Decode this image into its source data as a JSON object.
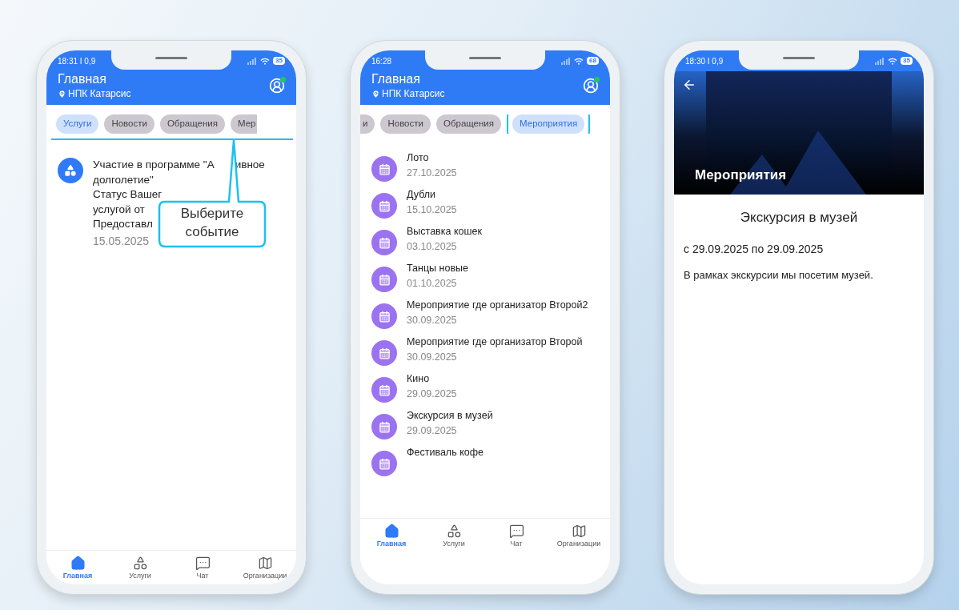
{
  "phones": [
    {
      "kind": "home",
      "status": {
        "time": "18:31 I 0,9",
        "battery": "35"
      },
      "header": {
        "title": "Главная",
        "location": "НПК Катарсис"
      },
      "tabs": [
        {
          "label": "Услуги",
          "selected": true,
          "highlighted": false
        },
        {
          "label": "Новости",
          "selected": false,
          "highlighted": false
        },
        {
          "label": "Обращения",
          "selected": false,
          "highlighted": false
        },
        {
          "label": "Мер",
          "selected": false,
          "highlighted": false,
          "clipped_right": true
        }
      ],
      "service": {
        "lines": [
          [
            "Участие в программе \"А",
            "ивное"
          ],
          [
            "долголетие\""
          ],
          [
            "Статус Вашег"
          ],
          [
            "услугой от"
          ],
          [
            "Предоставл"
          ]
        ],
        "date": "15.05.2025"
      },
      "callout": "Выберите событие",
      "nav": [
        {
          "label": "Главная",
          "selected": true
        },
        {
          "label": "Услуги",
          "selected": false
        },
        {
          "label": "Чат",
          "selected": false
        },
        {
          "label": "Организации",
          "selected": false
        }
      ]
    },
    {
      "kind": "events",
      "status": {
        "time": "16:28",
        "battery": "68"
      },
      "header": {
        "title": "Главная",
        "location": "НПК Катарсис"
      },
      "tabs": [
        {
          "label": "и",
          "selected": false,
          "highlighted": false,
          "clipped_left": true
        },
        {
          "label": "Новости",
          "selected": false,
          "highlighted": false
        },
        {
          "label": "Обращения",
          "selected": false,
          "highlighted": false
        },
        {
          "label": "Мероприятия",
          "selected": true,
          "highlighted": true
        }
      ],
      "events": [
        {
          "title": "Лото",
          "date": "27.10.2025"
        },
        {
          "title": "Дубли",
          "date": "15.10.2025"
        },
        {
          "title": "Выставка кошек",
          "date": "03.10.2025"
        },
        {
          "title": "Танцы новые",
          "date": "01.10.2025"
        },
        {
          "title": "Мероприятие где организатор Второй2",
          "date": "30.09.2025"
        },
        {
          "title": "Мероприятие где организатор Второй",
          "date": "30.09.2025"
        },
        {
          "title": "Кино",
          "date": "29.09.2025"
        },
        {
          "title": "Экскурсия в музей",
          "date": "29.09.2025"
        },
        {
          "title": "Фестиваль кофе"
        }
      ],
      "nav": [
        {
          "label": "Главная",
          "selected": true
        },
        {
          "label": "Услуги",
          "selected": false
        },
        {
          "label": "Чат",
          "selected": false
        },
        {
          "label": "Организации",
          "selected": false
        }
      ]
    },
    {
      "kind": "detail",
      "status": {
        "time": "18:30 I 0,9",
        "battery": "35"
      },
      "banner": "Мероприятия",
      "detail": {
        "title": "Экскурсия в музей",
        "dates": "с 29.09.2025 по 29.09.2025",
        "description": "В рамках экскурсии мы посетим музей."
      }
    }
  ]
}
